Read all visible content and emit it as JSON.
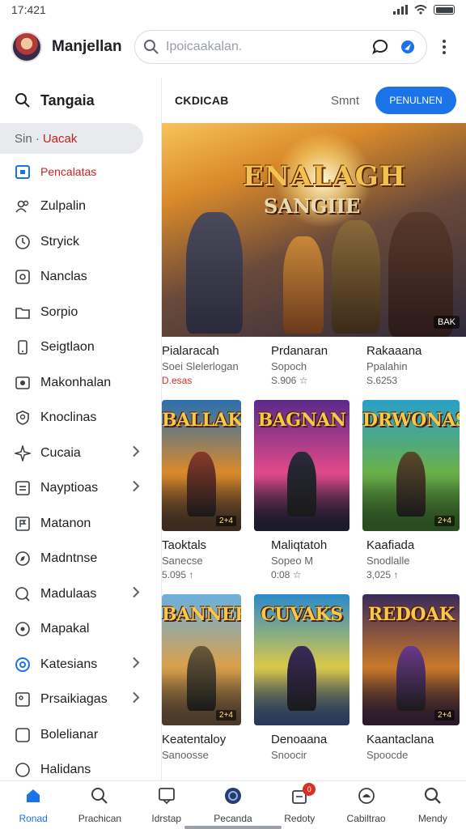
{
  "status_bar": {
    "time": "17:421"
  },
  "top_bar": {
    "account_name": "Manjellan",
    "search_placeholder": "Ipoicaakalan."
  },
  "sidebar": {
    "header": "Tangaia",
    "selected_prefix": "Sin ·",
    "selected_label": "Uacak",
    "items": [
      {
        "label": "Pencalatas",
        "icon": "calendar-icon",
        "chevron": false,
        "style": "red"
      },
      {
        "label": "Zulpalin",
        "icon": "people-icon",
        "chevron": false
      },
      {
        "label": "Stryick",
        "icon": "clock-icon",
        "chevron": false
      },
      {
        "label": "Nanclas",
        "icon": "square-dot-icon",
        "chevron": false
      },
      {
        "label": "Sorpio",
        "icon": "folder-icon",
        "chevron": false
      },
      {
        "label": "Seigtlaon",
        "icon": "phone-icon",
        "chevron": false
      },
      {
        "label": "Makonhalan",
        "icon": "photo-icon",
        "chevron": false
      },
      {
        "label": "Knoclinas",
        "icon": "shield-icon",
        "chevron": false
      },
      {
        "label": "Cucaia",
        "icon": "sparkle-icon",
        "chevron": true
      },
      {
        "label": "Nayptioas",
        "icon": "list-icon",
        "chevron": true
      },
      {
        "label": "Matanon",
        "icon": "flag-icon",
        "chevron": false
      },
      {
        "label": "Madntnse",
        "icon": "compass-icon",
        "chevron": false
      },
      {
        "label": "Madulaas",
        "icon": "search-circle-icon",
        "chevron": true
      },
      {
        "label": "Mapakal",
        "icon": "target-icon",
        "chevron": false
      },
      {
        "label": "Katesians",
        "icon": "blue-ring-icon",
        "chevron": true
      },
      {
        "label": "Prsaikiagas",
        "icon": "tag-icon",
        "chevron": true
      },
      {
        "label": "Bolelianar",
        "icon": "square-icon",
        "chevron": false
      },
      {
        "label": "Halidans",
        "icon": "circle-icon",
        "chevron": false
      }
    ]
  },
  "content": {
    "title": "CKDICAB",
    "link": "Smnt",
    "button": "PENULNEN",
    "hero": {
      "title": "ENALAGH",
      "subtitle": "SANGIIE",
      "badge": "BAK"
    },
    "row1": [
      {
        "name": "Pialaracah",
        "sub": "Soei Slelerlogan",
        "price": "D.esas",
        "price_red": true
      },
      {
        "name": "Prdanaran",
        "sub": "Sopoch",
        "price": "S.906 ☆",
        "price_red": false
      },
      {
        "name": "Rakaaana",
        "sub": "Ppalahin",
        "price": "S.6253",
        "price_red": false
      }
    ],
    "posters1": [
      {
        "title": "BALLAK",
        "rating": "2+4",
        "colors": [
          "#2a6fb0",
          "#d98a2a",
          "#3a2a20"
        ],
        "fig": "#8a3a2a"
      },
      {
        "title": "BAGNAN",
        "rating": "",
        "colors": [
          "#5a2a8a",
          "#e04a8a",
          "#1a1a2a"
        ],
        "fig": "#2a2a3a"
      },
      {
        "title": "DRWONAS",
        "rating": "2+4",
        "colors": [
          "#2aa0c8",
          "#6ab04a",
          "#2a4a20"
        ],
        "fig": "#5a4a2a"
      }
    ],
    "row2": [
      {
        "name": "Taoktals",
        "sub": "Sanecse",
        "price": "5.095 ↑",
        "price_red": false
      },
      {
        "name": "Maliqtatoh",
        "sub": "Sopeo M",
        "price": "0:08 ☆",
        "price_red": false
      },
      {
        "name": "Kaafiada",
        "sub": "Snodlalle",
        "price": "3,025 ↑",
        "price_red": false
      }
    ],
    "posters2": [
      {
        "title": "BANNER",
        "rating": "2+4",
        "colors": [
          "#6ab0e0",
          "#d9a04a",
          "#4a3a2a"
        ],
        "fig": "#6a5a3a"
      },
      {
        "title": "CUVAKS",
        "rating": "",
        "colors": [
          "#2a8ac8",
          "#d8c84a",
          "#2a3a5a"
        ],
        "fig": "#3a2a5a"
      },
      {
        "title": "REDOAK",
        "rating": "2+4",
        "colors": [
          "#3a2a5a",
          "#c8782a",
          "#2a1a2a"
        ],
        "fig": "#6a3a8a"
      }
    ],
    "row3": [
      {
        "name": "Keatentaloy",
        "sub": "Sanoosse",
        "price": "",
        "price_red": false
      },
      {
        "name": "Denoaana",
        "sub": "Snoocir",
        "price": "",
        "price_red": false
      },
      {
        "name": "Kaantaclana",
        "sub": "Spoocde",
        "price": "",
        "price_red": false
      }
    ]
  },
  "bottom_nav": [
    {
      "label": "Ronad",
      "icon": "home-icon",
      "active": true,
      "badge": ""
    },
    {
      "label": "Prachican",
      "icon": "search-icon",
      "active": false,
      "badge": ""
    },
    {
      "label": "Idrstap",
      "icon": "message-icon",
      "active": false,
      "badge": ""
    },
    {
      "label": "Pecanda",
      "icon": "round-logo-icon",
      "active": false,
      "badge": ""
    },
    {
      "label": "Redoty",
      "icon": "bag-icon",
      "active": false,
      "badge": "0"
    },
    {
      "label": "Cabiltrao",
      "icon": "dome-icon",
      "active": false,
      "badge": ""
    },
    {
      "label": "Mendy",
      "icon": "magnifier-icon",
      "active": false,
      "badge": ""
    }
  ],
  "colors": {
    "accent": "#1a73e8",
    "alert": "#d93025",
    "selected_bg": "#e8eaed"
  }
}
